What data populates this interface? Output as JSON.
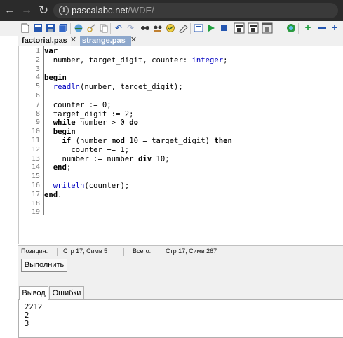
{
  "browser": {
    "url_host": "pascalabc.net",
    "url_path": "/WDE/"
  },
  "toolbar": {
    "icons": [
      "new-file",
      "open-file",
      "save-file",
      "save-all",
      "browse",
      "find-in-files",
      "undo",
      "redo",
      "find",
      "replace",
      "goto",
      "clear",
      "compile",
      "run",
      "stop",
      "build-exe",
      "run-exe",
      "web",
      "add",
      "remove"
    ]
  },
  "tabs": [
    {
      "label": "factorial.pas",
      "active": false
    },
    {
      "label": "strange.pas",
      "active": true
    }
  ],
  "editor": {
    "line_numbers": [
      "1",
      "2",
      "3",
      "4",
      "5",
      "6",
      "7",
      "8",
      "9",
      "10",
      "11",
      "12",
      "13",
      "14",
      "15",
      "16",
      "17",
      "18",
      "19"
    ],
    "lines": [
      [
        "var"
      ],
      [
        "  number, target_digit, counter: ",
        "integer",
        ";"
      ],
      [
        ""
      ],
      [
        "begin"
      ],
      [
        "  ",
        "readln",
        "(number, target_digit);"
      ],
      [
        ""
      ],
      [
        "  counter := 0;"
      ],
      [
        "  target_digit := 2;"
      ],
      [
        "  ",
        "while",
        " number > 0 ",
        "do"
      ],
      [
        "  ",
        "begin"
      ],
      [
        "    ",
        "if",
        " (number ",
        "mod",
        " 10 = target_digit) ",
        "then"
      ],
      [
        "      counter += 1;"
      ],
      [
        "    number := number ",
        "div",
        " 10;"
      ],
      [
        "  ",
        "end",
        ";"
      ],
      [
        ""
      ],
      [
        "  ",
        "writeln",
        "(counter);"
      ],
      [
        "end",
        "."
      ]
    ]
  },
  "status": {
    "pos_label": "Позиция:",
    "pos_value": "Стр 17, Симв 5",
    "total_label": "Всего:",
    "total_value": "Стр 17, Симв 267"
  },
  "run": {
    "label": "Выполнить"
  },
  "output": {
    "tabs": [
      "Вывод",
      "Ошибки"
    ],
    "lines": [
      "2212",
      "2",
      "3"
    ]
  }
}
